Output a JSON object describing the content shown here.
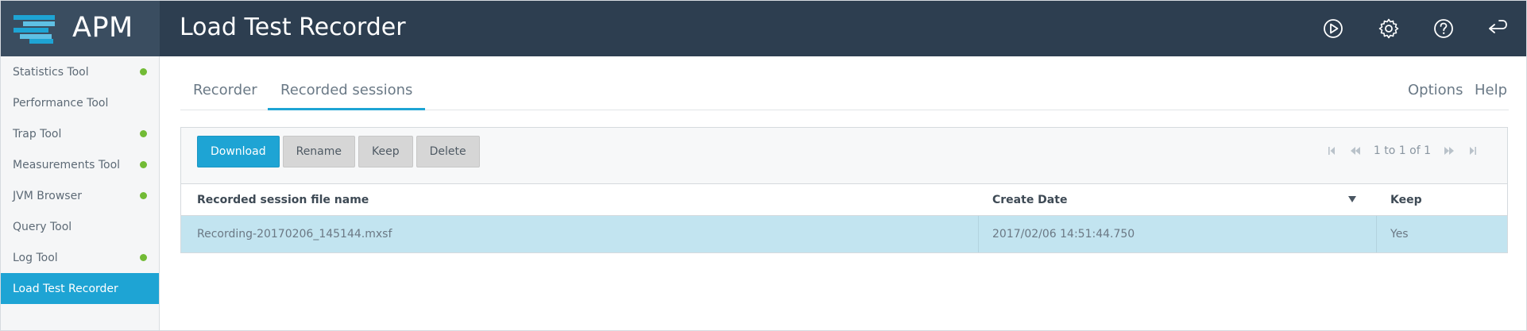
{
  "app": {
    "logo_text": "APM",
    "title": "Load Test Recorder"
  },
  "sidebar": {
    "items": [
      {
        "label": "Statistics Tool",
        "status": "green"
      },
      {
        "label": "Performance Tool",
        "status": "none"
      },
      {
        "label": "Trap Tool",
        "status": "green"
      },
      {
        "label": "Measurements Tool",
        "status": "green"
      },
      {
        "label": "JVM Browser",
        "status": "green"
      },
      {
        "label": "Query Tool",
        "status": "none"
      },
      {
        "label": "Log Tool",
        "status": "green"
      },
      {
        "label": "Load Test Recorder",
        "status": "none",
        "active": true
      }
    ]
  },
  "header": {
    "icons": [
      "play-icon",
      "gear-icon",
      "help-icon",
      "logout-icon"
    ]
  },
  "tabs": {
    "items": [
      "Recorder",
      "Recorded sessions"
    ],
    "active": "Recorded sessions",
    "right_links": [
      "Options",
      "Help"
    ]
  },
  "toolbar": {
    "download": "Download",
    "rename": "Rename",
    "keep": "Keep",
    "delete": "Delete"
  },
  "pager": {
    "text": "1 to 1 of 1"
  },
  "table": {
    "columns": [
      "Recorded session file name",
      "Create Date",
      "Keep"
    ],
    "rows": [
      [
        "Recording-20170206_145144.mxsf",
        "2017/02/06 14:51:44.750",
        "Yes"
      ]
    ]
  },
  "colors": {
    "accent": "#1ea4d4",
    "header_bg": "#2d3e50",
    "status_green": "#72bb35",
    "selected_row": "#c2e4f0"
  }
}
